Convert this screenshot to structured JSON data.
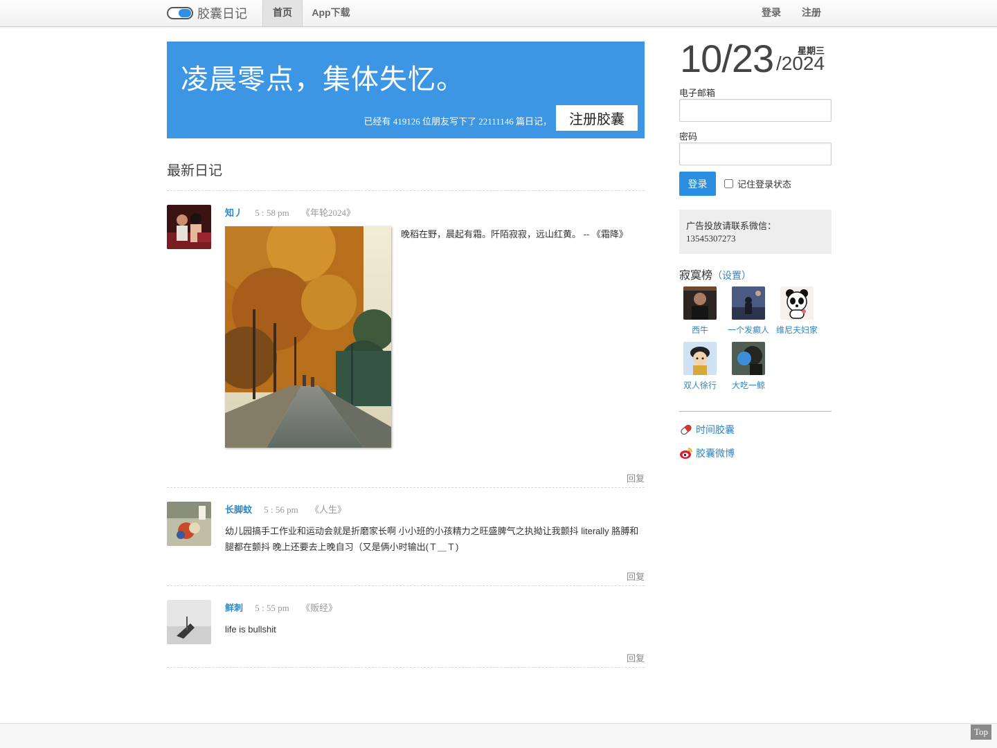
{
  "header": {
    "logo_text": "胶囊日记",
    "nav": {
      "home": "首页",
      "app": "App下载",
      "login": "登录",
      "register": "注册"
    }
  },
  "banner": {
    "slogan": "凌晨零点，集体失忆。",
    "stats": "已经有 419126 位朋友写下了 22111146 篇日记，",
    "button": "注册胶囊"
  },
  "main": {
    "section_title": "最新日记",
    "posts": [
      {
        "author": "知丿",
        "time": "5 : 58 pm",
        "book": "《年轮2024》",
        "text": "晚稻在野，晨起有霜。阡陌寂寂，远山红黄。 -- 《霜降》",
        "reply": "回复"
      },
      {
        "author": "长脚蚊",
        "time": "5 : 56 pm",
        "book": "《人生》",
        "text": "幼儿园搞手工作业和运动会就是折磨家长啊 小小班的小孩精力之旺盛脾气之执拗让我颤抖 literally 胳膊和腿都在颤抖 晚上还要去上晚自习（又是俩小时输出(Ｔ＿Ｔ)",
        "reply": "回复"
      },
      {
        "author": "鲜刺",
        "time": "5 : 55 pm",
        "book": "《贩经》",
        "text": "life is bullshit",
        "reply": "回复"
      }
    ]
  },
  "sidebar": {
    "date": {
      "md": "10/23",
      "year": "/2024",
      "weekday": "星期三"
    },
    "email_label": "电子邮箱",
    "email_value": "",
    "password_label": "密码",
    "password_value": "",
    "login_button": "登录",
    "remember_label": "记住登录状态",
    "ad_line1": "广告投放请联系微信：",
    "ad_line2": "13545307273",
    "lonely_title": "寂寞榜",
    "lonely_settings": "（设置）",
    "friends": [
      "西牛",
      "一个发癫人",
      "维尼夫妇家",
      "双人徐行",
      "大吃一鲸"
    ],
    "links": [
      "时间胶囊",
      "胶囊微博"
    ]
  },
  "footer": {
    "top": "Top"
  }
}
